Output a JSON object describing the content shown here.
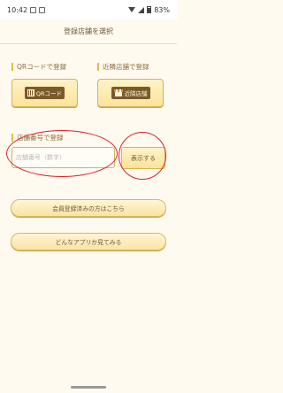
{
  "status_bar": {
    "time": "10:42",
    "battery": "83%"
  },
  "header": {
    "title": "登録店舗を選択"
  },
  "qr_section": {
    "label": "QRコードで登録",
    "button_label": "QRコード"
  },
  "nearby_section": {
    "label": "近隣店舗で登録",
    "button_label": "近隣店舗"
  },
  "store_number_section": {
    "label": "店舗番号で登録",
    "input_placeholder": "店舗番号（数字）",
    "show_button_label": "表示する"
  },
  "member_button": {
    "label": "会員登録済みの方はこちら"
  },
  "preview_button": {
    "label": "どんなアプリか見てみる"
  },
  "colors": {
    "accent": "#e2b94e",
    "annotation": "#d9232e"
  }
}
